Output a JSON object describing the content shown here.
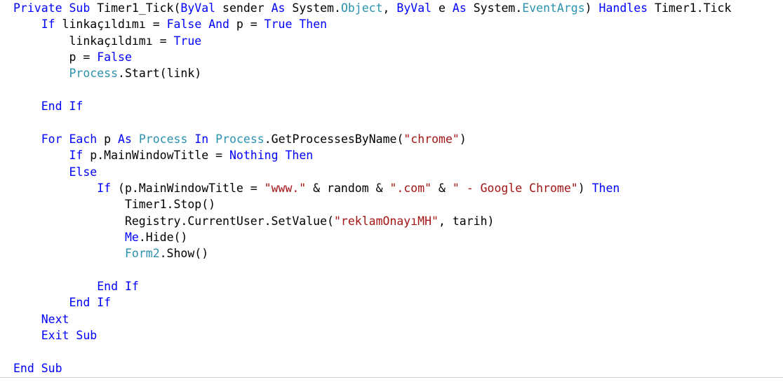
{
  "colors": {
    "keyword": "#0000ff",
    "type": "#2b91af",
    "string": "#a31515",
    "plain": "#000000",
    "background": "#ffffff"
  },
  "lines": [
    [
      {
        "t": "Private Sub",
        "c": "kw"
      },
      {
        "t": " Timer1_Tick(",
        "c": "pl"
      },
      {
        "t": "ByVal",
        "c": "kw"
      },
      {
        "t": " sender ",
        "c": "pl"
      },
      {
        "t": "As",
        "c": "kw"
      },
      {
        "t": " System.",
        "c": "pl"
      },
      {
        "t": "Object",
        "c": "ty"
      },
      {
        "t": ", ",
        "c": "pl"
      },
      {
        "t": "ByVal",
        "c": "kw"
      },
      {
        "t": " e ",
        "c": "pl"
      },
      {
        "t": "As",
        "c": "kw"
      },
      {
        "t": " System.",
        "c": "pl"
      },
      {
        "t": "EventArgs",
        "c": "ty"
      },
      {
        "t": ") ",
        "c": "pl"
      },
      {
        "t": "Handles",
        "c": "kw"
      },
      {
        "t": " Timer1.Tick",
        "c": "pl"
      }
    ],
    [
      {
        "t": "    ",
        "c": "pl"
      },
      {
        "t": "If",
        "c": "kw"
      },
      {
        "t": " linkaçıldımı = ",
        "c": "pl"
      },
      {
        "t": "False",
        "c": "kw"
      },
      {
        "t": " ",
        "c": "pl"
      },
      {
        "t": "And",
        "c": "kw"
      },
      {
        "t": " p = ",
        "c": "pl"
      },
      {
        "t": "True",
        "c": "kw"
      },
      {
        "t": " ",
        "c": "pl"
      },
      {
        "t": "Then",
        "c": "kw"
      }
    ],
    [
      {
        "t": "        linkaçıldımı = ",
        "c": "pl"
      },
      {
        "t": "True",
        "c": "kw"
      }
    ],
    [
      {
        "t": "        p = ",
        "c": "pl"
      },
      {
        "t": "False",
        "c": "kw"
      }
    ],
    [
      {
        "t": "        ",
        "c": "pl"
      },
      {
        "t": "Process",
        "c": "ty"
      },
      {
        "t": ".Start(link)",
        "c": "pl"
      }
    ],
    [],
    [
      {
        "t": "    ",
        "c": "pl"
      },
      {
        "t": "End If",
        "c": "kw"
      }
    ],
    [],
    [
      {
        "t": "    ",
        "c": "pl"
      },
      {
        "t": "For Each",
        "c": "kw"
      },
      {
        "t": " p ",
        "c": "pl"
      },
      {
        "t": "As",
        "c": "kw"
      },
      {
        "t": " ",
        "c": "pl"
      },
      {
        "t": "Process",
        "c": "ty"
      },
      {
        "t": " ",
        "c": "pl"
      },
      {
        "t": "In",
        "c": "kw"
      },
      {
        "t": " ",
        "c": "pl"
      },
      {
        "t": "Process",
        "c": "ty"
      },
      {
        "t": ".GetProcessesByName(",
        "c": "pl"
      },
      {
        "t": "\"chrome\"",
        "c": "st"
      },
      {
        "t": ")",
        "c": "pl"
      }
    ],
    [
      {
        "t": "        ",
        "c": "pl"
      },
      {
        "t": "If",
        "c": "kw"
      },
      {
        "t": " p.MainWindowTitle = ",
        "c": "pl"
      },
      {
        "t": "Nothing",
        "c": "kw"
      },
      {
        "t": " ",
        "c": "pl"
      },
      {
        "t": "Then",
        "c": "kw"
      }
    ],
    [
      {
        "t": "        ",
        "c": "pl"
      },
      {
        "t": "Else",
        "c": "kw"
      }
    ],
    [
      {
        "t": "            ",
        "c": "pl"
      },
      {
        "t": "If",
        "c": "kw"
      },
      {
        "t": " (p.MainWindowTitle = ",
        "c": "pl"
      },
      {
        "t": "\"www.\"",
        "c": "st"
      },
      {
        "t": " & random & ",
        "c": "pl"
      },
      {
        "t": "\".com\"",
        "c": "st"
      },
      {
        "t": " & ",
        "c": "pl"
      },
      {
        "t": "\" - Google Chrome\"",
        "c": "st"
      },
      {
        "t": ") ",
        "c": "pl"
      },
      {
        "t": "Then",
        "c": "kw"
      }
    ],
    [
      {
        "t": "                Timer1.Stop()",
        "c": "pl"
      }
    ],
    [
      {
        "t": "                Registry.CurrentUser.SetValue(",
        "c": "pl"
      },
      {
        "t": "\"reklamOnayıMH\"",
        "c": "st"
      },
      {
        "t": ", tarih)",
        "c": "pl"
      }
    ],
    [
      {
        "t": "                ",
        "c": "pl"
      },
      {
        "t": "Me",
        "c": "kw"
      },
      {
        "t": ".Hide()",
        "c": "pl"
      }
    ],
    [
      {
        "t": "                ",
        "c": "pl"
      },
      {
        "t": "Form2",
        "c": "ty"
      },
      {
        "t": ".Show()",
        "c": "pl"
      }
    ],
    [],
    [
      {
        "t": "            ",
        "c": "pl"
      },
      {
        "t": "End If",
        "c": "kw"
      }
    ],
    [
      {
        "t": "        ",
        "c": "pl"
      },
      {
        "t": "End If",
        "c": "kw"
      }
    ],
    [
      {
        "t": "    ",
        "c": "pl"
      },
      {
        "t": "Next",
        "c": "kw"
      }
    ],
    [
      {
        "t": "    ",
        "c": "pl"
      },
      {
        "t": "Exit Sub",
        "c": "kw"
      }
    ],
    [],
    [
      {
        "t": "End Sub",
        "c": "kw"
      }
    ]
  ]
}
